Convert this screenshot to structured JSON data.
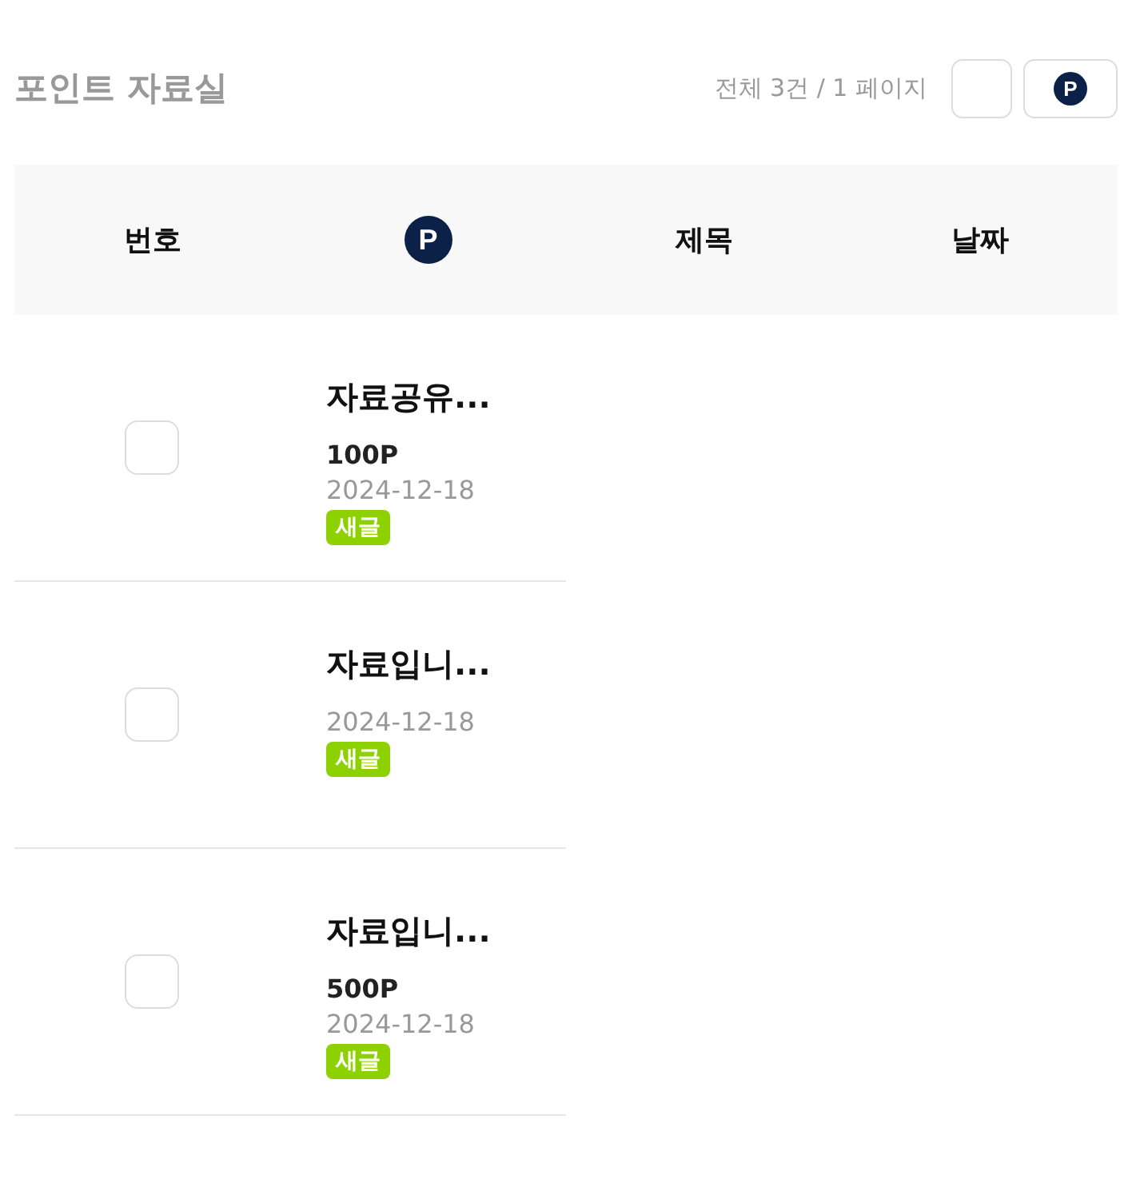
{
  "title": "포인트 자료실",
  "summary": "전체 3건 / 1 페이지",
  "toolbar": {
    "select_all_checked": false,
    "point_icon": "P"
  },
  "table": {
    "columns": [
      {
        "kind": "text",
        "label": "번호"
      },
      {
        "kind": "icon",
        "label": "P"
      },
      {
        "kind": "text",
        "label": "제목"
      },
      {
        "kind": "text",
        "label": "날짜"
      }
    ],
    "rows": [
      {
        "checked": false,
        "title": "자료공유...",
        "points": "100P",
        "date": "2024-12-18",
        "badge": "새글"
      },
      {
        "checked": false,
        "title": "자료입니...",
        "date": "2024-12-18",
        "badge": "새글"
      },
      {
        "checked": false,
        "title": "자료입니...",
        "points": "500P",
        "date": "2024-12-18",
        "badge": "새글"
      }
    ]
  }
}
